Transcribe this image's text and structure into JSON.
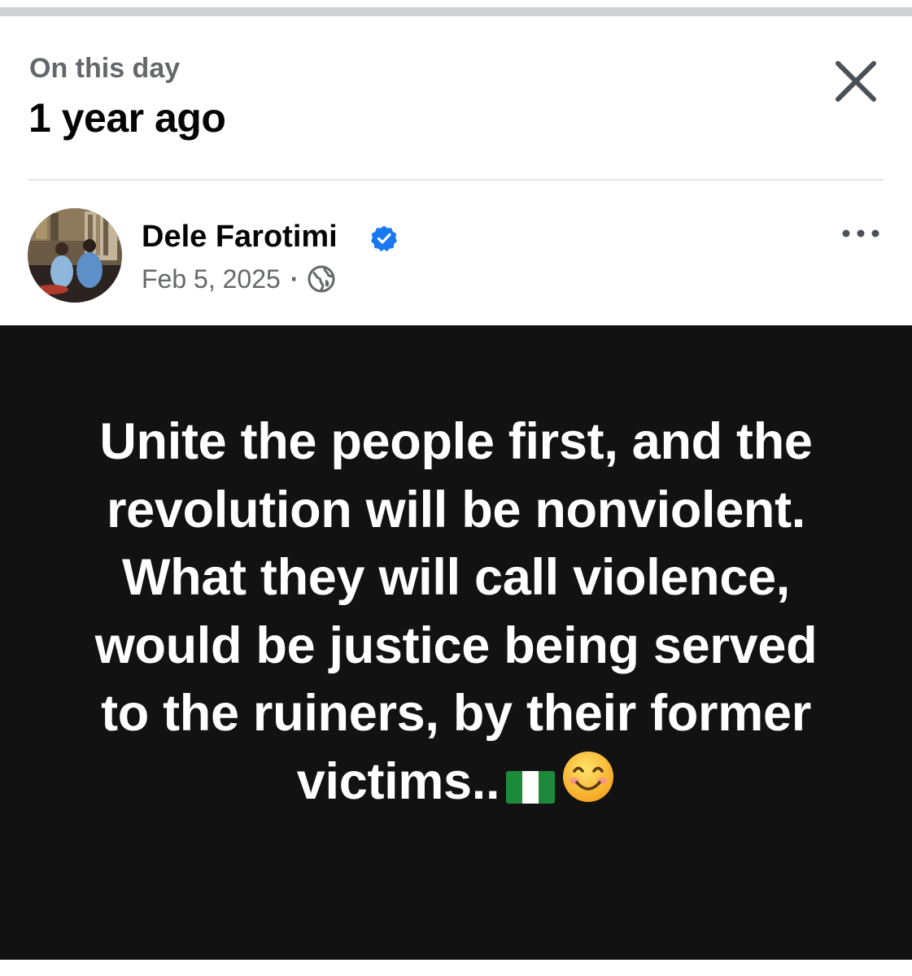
{
  "header": {
    "subtitle": "On this day",
    "title": "1 year ago"
  },
  "post": {
    "author": "Dele Farotimi",
    "date": "Feb 5, 2025",
    "separator": "·",
    "audience_icon": "globe-icon",
    "verified_icon": "verified-badge-icon",
    "text": "Unite the people first, and the revolution will be nonviolent. What they will call violence, would be justice being served to the ruiners, by their former victims..",
    "emoji": [
      "nigeria-flag-icon",
      "smiling-face-icon"
    ]
  },
  "colors": {
    "background": "#ffffff",
    "post_background": "#121212",
    "post_text": "#ffffff",
    "secondary_text": "#65676b",
    "verified_blue": "#1877f2"
  }
}
